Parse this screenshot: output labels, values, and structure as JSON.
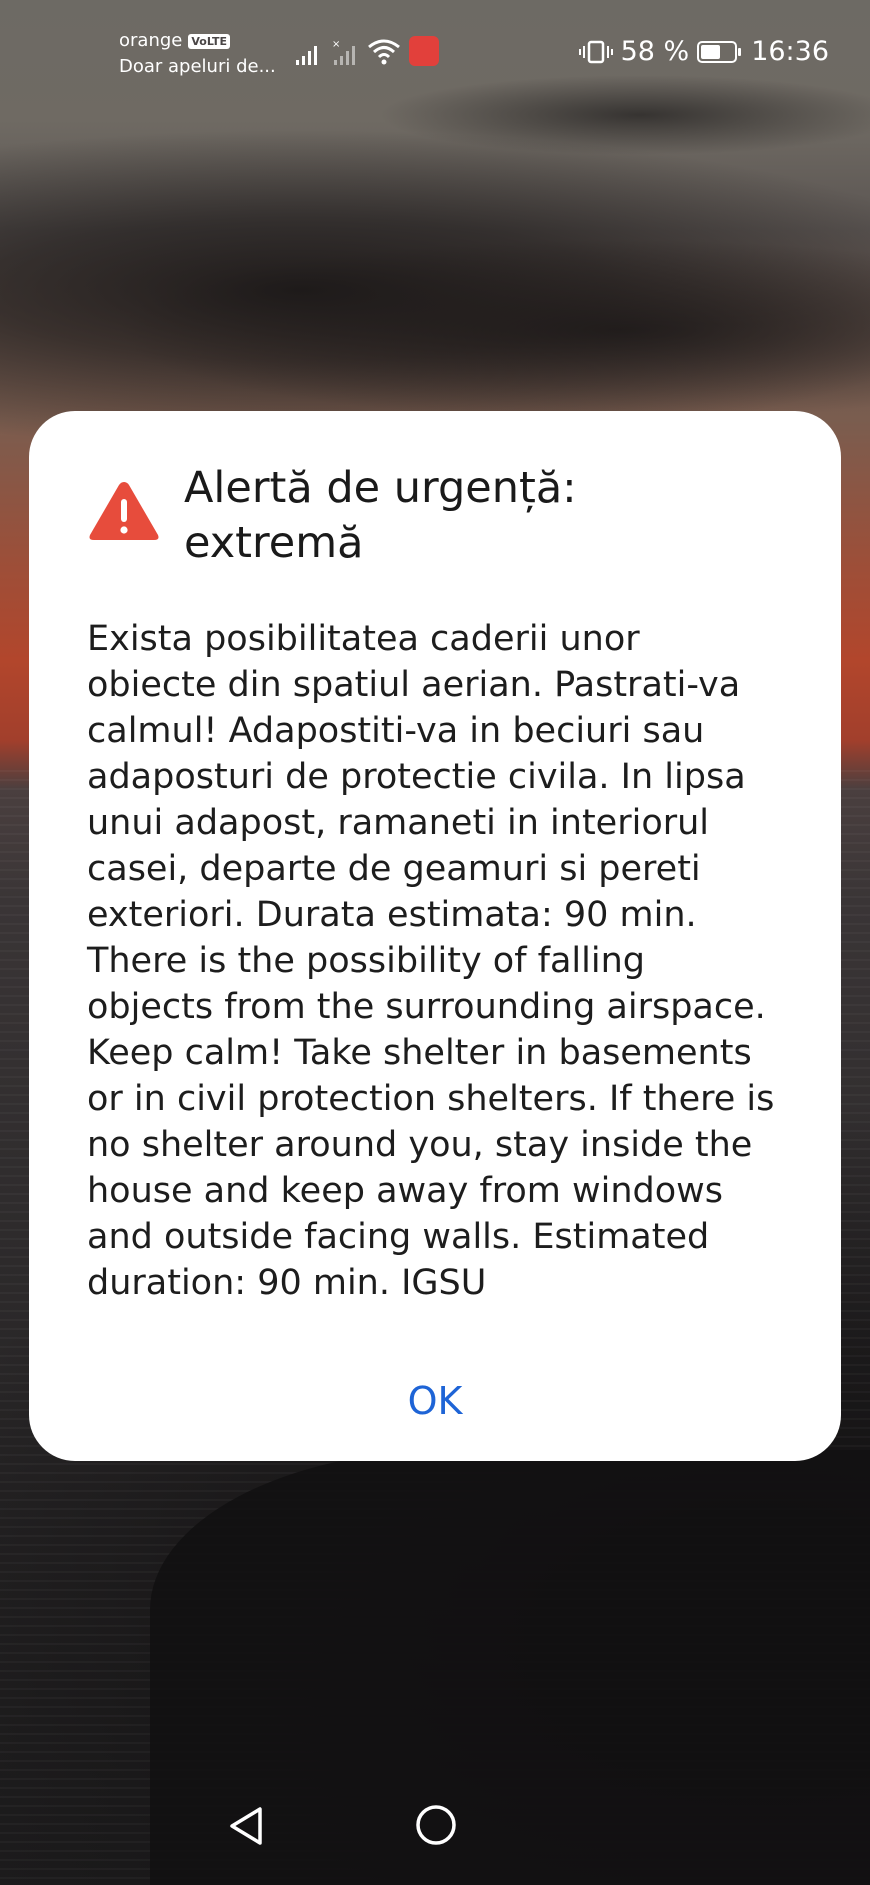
{
  "status_bar": {
    "carrier": "orange",
    "volte_badge": "VoLTE",
    "carrier_status": "Doar apeluri de...",
    "battery_percent": "58 %",
    "battery_level": 0.58,
    "time": "16:36",
    "icons": [
      "signal-icon",
      "signal-no-service-icon",
      "wifi-icon",
      "app-store-icon",
      "vibrate-icon",
      "battery-icon"
    ]
  },
  "alert": {
    "icon": "warning-triangle-icon",
    "title": "Alertă de urgență: extremă",
    "message": "Exista posibilitatea caderii unor\nobiecte din spatiul aerian. Pastrati-va\ncalmul! Adapostiti-va in beciuri sau\nadaposturi de protectie civila. In lipsa\nunui adapost, ramaneti in interiorul\ncasei, departe de geamuri si pereti\nexteriori. Durata estimata: 90 min.\nThere is the possibility of falling\nobjects from the surrounding airspace.\nKeep calm! Take shelter in basements\nor in civil protection shelters. If there is\nno shelter around you, stay inside the\nhouse and keep away from windows\nand outside facing walls. Estimated\nduration: 90 min. IGSU",
    "ok_label": "OK"
  },
  "navigation": {
    "icons": [
      "back-icon",
      "home-icon"
    ]
  },
  "colors": {
    "warning": "#e74c3c",
    "accent": "#1e64d6",
    "dialog_bg": "#ffffff"
  }
}
